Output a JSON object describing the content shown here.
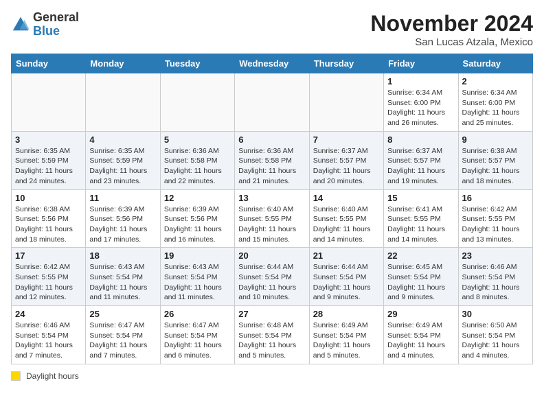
{
  "logo": {
    "general": "General",
    "blue": "Blue"
  },
  "title": "November 2024",
  "subtitle": "San Lucas Atzala, Mexico",
  "days_of_week": [
    "Sunday",
    "Monday",
    "Tuesday",
    "Wednesday",
    "Thursday",
    "Friday",
    "Saturday"
  ],
  "legend_label": "Daylight hours",
  "weeks": [
    [
      {
        "day": "",
        "info": ""
      },
      {
        "day": "",
        "info": ""
      },
      {
        "day": "",
        "info": ""
      },
      {
        "day": "",
        "info": ""
      },
      {
        "day": "",
        "info": ""
      },
      {
        "day": "1",
        "info": "Sunrise: 6:34 AM\nSunset: 6:00 PM\nDaylight: 11 hours and 26 minutes."
      },
      {
        "day": "2",
        "info": "Sunrise: 6:34 AM\nSunset: 6:00 PM\nDaylight: 11 hours and 25 minutes."
      }
    ],
    [
      {
        "day": "3",
        "info": "Sunrise: 6:35 AM\nSunset: 5:59 PM\nDaylight: 11 hours and 24 minutes."
      },
      {
        "day": "4",
        "info": "Sunrise: 6:35 AM\nSunset: 5:59 PM\nDaylight: 11 hours and 23 minutes."
      },
      {
        "day": "5",
        "info": "Sunrise: 6:36 AM\nSunset: 5:58 PM\nDaylight: 11 hours and 22 minutes."
      },
      {
        "day": "6",
        "info": "Sunrise: 6:36 AM\nSunset: 5:58 PM\nDaylight: 11 hours and 21 minutes."
      },
      {
        "day": "7",
        "info": "Sunrise: 6:37 AM\nSunset: 5:57 PM\nDaylight: 11 hours and 20 minutes."
      },
      {
        "day": "8",
        "info": "Sunrise: 6:37 AM\nSunset: 5:57 PM\nDaylight: 11 hours and 19 minutes."
      },
      {
        "day": "9",
        "info": "Sunrise: 6:38 AM\nSunset: 5:57 PM\nDaylight: 11 hours and 18 minutes."
      }
    ],
    [
      {
        "day": "10",
        "info": "Sunrise: 6:38 AM\nSunset: 5:56 PM\nDaylight: 11 hours and 18 minutes."
      },
      {
        "day": "11",
        "info": "Sunrise: 6:39 AM\nSunset: 5:56 PM\nDaylight: 11 hours and 17 minutes."
      },
      {
        "day": "12",
        "info": "Sunrise: 6:39 AM\nSunset: 5:56 PM\nDaylight: 11 hours and 16 minutes."
      },
      {
        "day": "13",
        "info": "Sunrise: 6:40 AM\nSunset: 5:55 PM\nDaylight: 11 hours and 15 minutes."
      },
      {
        "day": "14",
        "info": "Sunrise: 6:40 AM\nSunset: 5:55 PM\nDaylight: 11 hours and 14 minutes."
      },
      {
        "day": "15",
        "info": "Sunrise: 6:41 AM\nSunset: 5:55 PM\nDaylight: 11 hours and 14 minutes."
      },
      {
        "day": "16",
        "info": "Sunrise: 6:42 AM\nSunset: 5:55 PM\nDaylight: 11 hours and 13 minutes."
      }
    ],
    [
      {
        "day": "17",
        "info": "Sunrise: 6:42 AM\nSunset: 5:55 PM\nDaylight: 11 hours and 12 minutes."
      },
      {
        "day": "18",
        "info": "Sunrise: 6:43 AM\nSunset: 5:54 PM\nDaylight: 11 hours and 11 minutes."
      },
      {
        "day": "19",
        "info": "Sunrise: 6:43 AM\nSunset: 5:54 PM\nDaylight: 11 hours and 11 minutes."
      },
      {
        "day": "20",
        "info": "Sunrise: 6:44 AM\nSunset: 5:54 PM\nDaylight: 11 hours and 10 minutes."
      },
      {
        "day": "21",
        "info": "Sunrise: 6:44 AM\nSunset: 5:54 PM\nDaylight: 11 hours and 9 minutes."
      },
      {
        "day": "22",
        "info": "Sunrise: 6:45 AM\nSunset: 5:54 PM\nDaylight: 11 hours and 9 minutes."
      },
      {
        "day": "23",
        "info": "Sunrise: 6:46 AM\nSunset: 5:54 PM\nDaylight: 11 hours and 8 minutes."
      }
    ],
    [
      {
        "day": "24",
        "info": "Sunrise: 6:46 AM\nSunset: 5:54 PM\nDaylight: 11 hours and 7 minutes."
      },
      {
        "day": "25",
        "info": "Sunrise: 6:47 AM\nSunset: 5:54 PM\nDaylight: 11 hours and 7 minutes."
      },
      {
        "day": "26",
        "info": "Sunrise: 6:47 AM\nSunset: 5:54 PM\nDaylight: 11 hours and 6 minutes."
      },
      {
        "day": "27",
        "info": "Sunrise: 6:48 AM\nSunset: 5:54 PM\nDaylight: 11 hours and 5 minutes."
      },
      {
        "day": "28",
        "info": "Sunrise: 6:49 AM\nSunset: 5:54 PM\nDaylight: 11 hours and 5 minutes."
      },
      {
        "day": "29",
        "info": "Sunrise: 6:49 AM\nSunset: 5:54 PM\nDaylight: 11 hours and 4 minutes."
      },
      {
        "day": "30",
        "info": "Sunrise: 6:50 AM\nSunset: 5:54 PM\nDaylight: 11 hours and 4 minutes."
      }
    ]
  ]
}
